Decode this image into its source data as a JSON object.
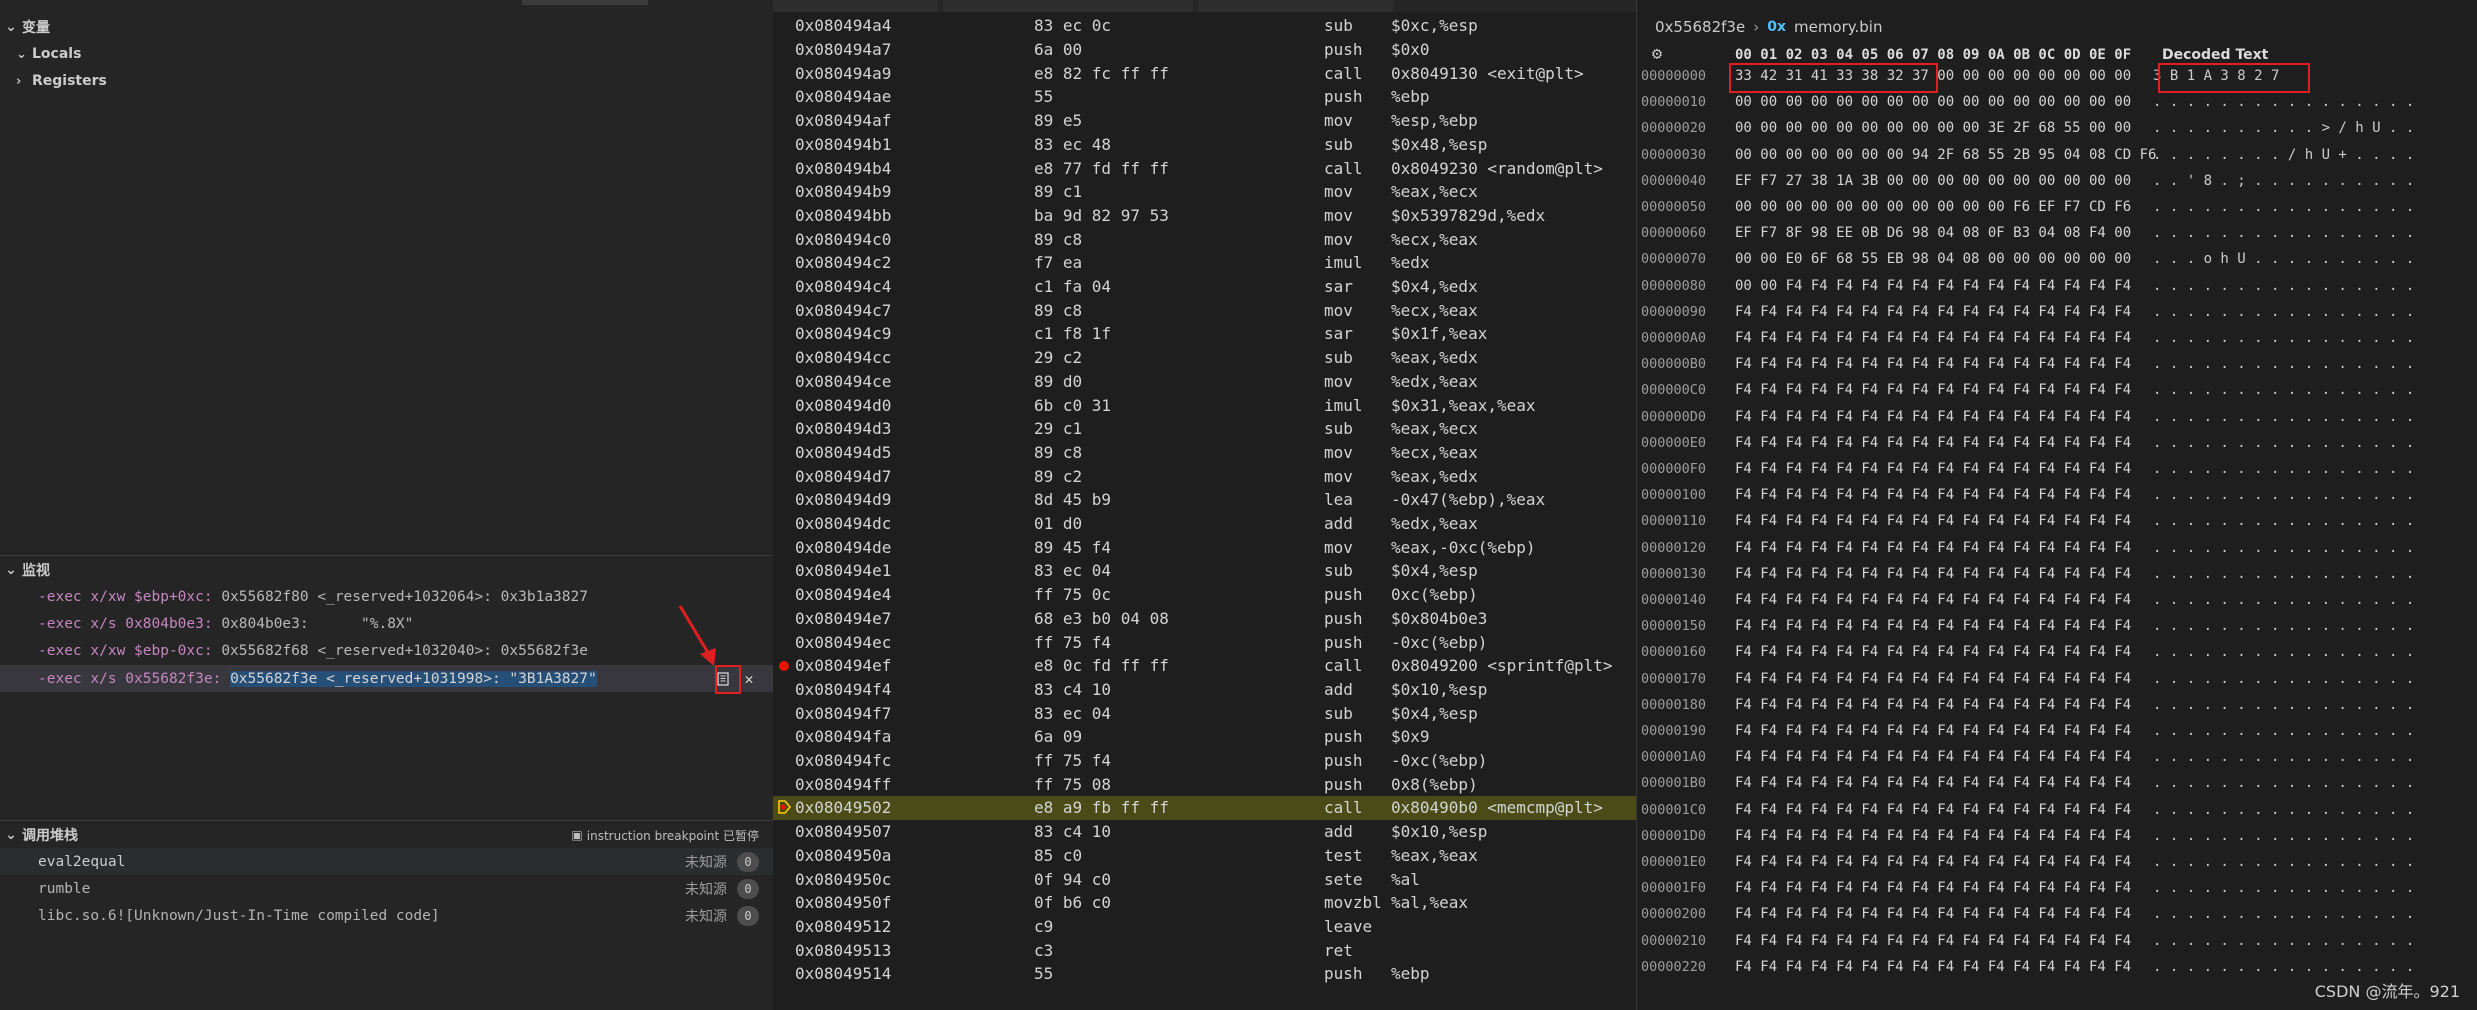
{
  "left_panel": {
    "variables": {
      "title": "变量",
      "items": [
        "Locals",
        "Registers"
      ]
    },
    "watch": {
      "title": "监视",
      "items": [
        {
          "expr": "-exec x/xw $ebp+0xc: ",
          "value": "0x55682f80 <_reserved+1032064>: 0x3b1a3827"
        },
        {
          "expr": "-exec x/s 0x804b0e3: ",
          "value": "0x804b0e3:      \"%.8X\""
        },
        {
          "expr": "-exec x/xw $ebp-0xc: ",
          "value": "0x55682f68 <_reserved+1032040>: 0x55682f3e"
        },
        {
          "expr": "-exec x/s 0x55682f3e: ",
          "value": "0x55682f3e <_reserved+1031998>: \"3B1A3827\""
        }
      ],
      "copy_icon": "copy-icon",
      "close_icon": "close-icon"
    },
    "call_stack": {
      "title": "调用堆栈",
      "status": "instruction breakpoint 已暂停",
      "frames": [
        {
          "name": "eval2equal",
          "source": "未知源",
          "badge": "0"
        },
        {
          "name": "rumble",
          "source": "未知源",
          "badge": "0"
        },
        {
          "name": "libc.so.6![Unknown/Just-In-Time compiled code]",
          "source": "未知源",
          "badge": "0"
        }
      ]
    }
  },
  "disassembly": {
    "rows": [
      {
        "addr": "0x080494a4",
        "bytes": "83 ec 0c",
        "mn": "sub",
        "ops": "$0xc,%esp"
      },
      {
        "addr": "0x080494a7",
        "bytes": "6a 00",
        "mn": "push",
        "ops": "$0x0"
      },
      {
        "addr": "0x080494a9",
        "bytes": "e8 82 fc ff ff",
        "mn": "call",
        "ops": "0x8049130 <exit@plt>"
      },
      {
        "addr": "0x080494ae",
        "bytes": "55",
        "mn": "push",
        "ops": "%ebp"
      },
      {
        "addr": "0x080494af",
        "bytes": "89 e5",
        "mn": "mov",
        "ops": "%esp,%ebp"
      },
      {
        "addr": "0x080494b1",
        "bytes": "83 ec 48",
        "mn": "sub",
        "ops": "$0x48,%esp"
      },
      {
        "addr": "0x080494b4",
        "bytes": "e8 77 fd ff ff",
        "mn": "call",
        "ops": "0x8049230 <random@plt>"
      },
      {
        "addr": "0x080494b9",
        "bytes": "89 c1",
        "mn": "mov",
        "ops": "%eax,%ecx"
      },
      {
        "addr": "0x080494bb",
        "bytes": "ba 9d 82 97 53",
        "mn": "mov",
        "ops": "$0x5397829d,%edx"
      },
      {
        "addr": "0x080494c0",
        "bytes": "89 c8",
        "mn": "mov",
        "ops": "%ecx,%eax"
      },
      {
        "addr": "0x080494c2",
        "bytes": "f7 ea",
        "mn": "imul",
        "ops": "%edx"
      },
      {
        "addr": "0x080494c4",
        "bytes": "c1 fa 04",
        "mn": "sar",
        "ops": "$0x4,%edx"
      },
      {
        "addr": "0x080494c7",
        "bytes": "89 c8",
        "mn": "mov",
        "ops": "%ecx,%eax"
      },
      {
        "addr": "0x080494c9",
        "bytes": "c1 f8 1f",
        "mn": "sar",
        "ops": "$0x1f,%eax"
      },
      {
        "addr": "0x080494cc",
        "bytes": "29 c2",
        "mn": "sub",
        "ops": "%eax,%edx"
      },
      {
        "addr": "0x080494ce",
        "bytes": "89 d0",
        "mn": "mov",
        "ops": "%edx,%eax"
      },
      {
        "addr": "0x080494d0",
        "bytes": "6b c0 31",
        "mn": "imul",
        "ops": "$0x31,%eax,%eax"
      },
      {
        "addr": "0x080494d3",
        "bytes": "29 c1",
        "mn": "sub",
        "ops": "%eax,%ecx"
      },
      {
        "addr": "0x080494d5",
        "bytes": "89 c8",
        "mn": "mov",
        "ops": "%ecx,%eax"
      },
      {
        "addr": "0x080494d7",
        "bytes": "89 c2",
        "mn": "mov",
        "ops": "%eax,%edx"
      },
      {
        "addr": "0x080494d9",
        "bytes": "8d 45 b9",
        "mn": "lea",
        "ops": "-0x47(%ebp),%eax"
      },
      {
        "addr": "0x080494dc",
        "bytes": "01 d0",
        "mn": "add",
        "ops": "%edx,%eax"
      },
      {
        "addr": "0x080494de",
        "bytes": "89 45 f4",
        "mn": "mov",
        "ops": "%eax,-0xc(%ebp)"
      },
      {
        "addr": "0x080494e1",
        "bytes": "83 ec 04",
        "mn": "sub",
        "ops": "$0x4,%esp"
      },
      {
        "addr": "0x080494e4",
        "bytes": "ff 75 0c",
        "mn": "push",
        "ops": "0xc(%ebp)"
      },
      {
        "addr": "0x080494e7",
        "bytes": "68 e3 b0 04 08",
        "mn": "push",
        "ops": "$0x804b0e3"
      },
      {
        "addr": "0x080494ec",
        "bytes": "ff 75 f4",
        "mn": "push",
        "ops": "-0xc(%ebp)"
      },
      {
        "addr": "0x080494ef",
        "bytes": "e8 0c fd ff ff",
        "mn": "call",
        "ops": "0x8049200 <sprintf@plt>",
        "breakpoint": true
      },
      {
        "addr": "0x080494f4",
        "bytes": "83 c4 10",
        "mn": "add",
        "ops": "$0x10,%esp"
      },
      {
        "addr": "0x080494f7",
        "bytes": "83 ec 04",
        "mn": "sub",
        "ops": "$0x4,%esp"
      },
      {
        "addr": "0x080494fa",
        "bytes": "6a 09",
        "mn": "push",
        "ops": "$0x9"
      },
      {
        "addr": "0x080494fc",
        "bytes": "ff 75 f4",
        "mn": "push",
        "ops": "-0xc(%ebp)"
      },
      {
        "addr": "0x080494ff",
        "bytes": "ff 75 08",
        "mn": "push",
        "ops": "0x8(%ebp)"
      },
      {
        "addr": "0x08049502",
        "bytes": "e8 a9 fb ff ff",
        "mn": "call",
        "ops": "0x80490b0 <memcmp@plt>",
        "current": true
      },
      {
        "addr": "0x08049507",
        "bytes": "83 c4 10",
        "mn": "add",
        "ops": "$0x10,%esp"
      },
      {
        "addr": "0x0804950a",
        "bytes": "85 c0",
        "mn": "test",
        "ops": "%eax,%eax"
      },
      {
        "addr": "0x0804950c",
        "bytes": "0f 94 c0",
        "mn": "sete",
        "ops": "%al"
      },
      {
        "addr": "0x0804950f",
        "bytes": "0f b6 c0",
        "mn": "movzbl",
        "ops": "%al,%eax"
      },
      {
        "addr": "0x08049512",
        "bytes": "c9",
        "mn": "leave",
        "ops": ""
      },
      {
        "addr": "0x08049513",
        "bytes": "c3",
        "mn": "ret",
        "ops": ""
      },
      {
        "addr": "0x08049514",
        "bytes": "55",
        "mn": "push",
        "ops": "%ebp"
      }
    ]
  },
  "memory": {
    "address": "0x55682f3e",
    "hex_label": "0x",
    "file": "memory.bin",
    "header": "00 01 02 03 04 05 06 07 08 09 0A 0B 0C 0D 0E 0F",
    "decoded_header": "Decoded Text",
    "rows": [
      {
        "off": "00000000",
        "hex": "33 42 31 41 33 38 32 37 00 00 00 00 00 00 00 00",
        "txt": "3 B 1 A 3 8 2 7"
      },
      {
        "off": "00000010",
        "hex": "00 00 00 00 00 00 00 00 00 00 00 00 00 00 00 00",
        "txt": ". . . . . . . . . . . . . . . ."
      },
      {
        "off": "00000020",
        "hex": "00 00 00 00 00 00 00 00 00 00 3E 2F 68 55 00 00",
        "txt": ". . . . . . . . . . > / h U . ."
      },
      {
        "off": "00000030",
        "hex": "00 00 00 00 00 00 00 94 2F 68 55 2B 95 04 08 CD F6",
        "txt": ". . . . . . . . / h U + . . . ."
      },
      {
        "off": "00000040",
        "hex": "EF F7 27 38 1A 3B 00 00 00 00 00 00 00 00 00 00",
        "txt": ". . ' 8 . ; . . . . . . . . . ."
      },
      {
        "off": "00000050",
        "hex": "00 00 00 00 00 00 00 00 00 00 00 F6 EF F7 CD F6",
        "txt": ". . . . . . . . . . . . . . . ."
      },
      {
        "off": "00000060",
        "hex": "EF F7 8F 98 EE 0B D6 98 04 08 0F B3 04 08 F4 00",
        "txt": ". . . . . . . . . . . . . . . ."
      },
      {
        "off": "00000070",
        "hex": "00 00 E0 6F 68 55 EB 98 04 08 00 00 00 00 00 00",
        "txt": ". . . o h U . . . . . . . . . ."
      },
      {
        "off": "00000080",
        "hex": "00 00 F4 F4 F4 F4 F4 F4 F4 F4 F4 F4 F4 F4 F4 F4",
        "txt": ". . . . . . . . . . . . . . . ."
      },
      {
        "off": "00000090",
        "hex": "F4 F4 F4 F4 F4 F4 F4 F4 F4 F4 F4 F4 F4 F4 F4 F4",
        "txt": ". . . . . . . . . . . . . . . ."
      },
      {
        "off": "000000A0",
        "hex": "F4 F4 F4 F4 F4 F4 F4 F4 F4 F4 F4 F4 F4 F4 F4 F4",
        "txt": ". . . . . . . . . . . . . . . ."
      },
      {
        "off": "000000B0",
        "hex": "F4 F4 F4 F4 F4 F4 F4 F4 F4 F4 F4 F4 F4 F4 F4 F4",
        "txt": ". . . . . . . . . . . . . . . ."
      },
      {
        "off": "000000C0",
        "hex": "F4 F4 F4 F4 F4 F4 F4 F4 F4 F4 F4 F4 F4 F4 F4 F4",
        "txt": ". . . . . . . . . . . . . . . ."
      },
      {
        "off": "000000D0",
        "hex": "F4 F4 F4 F4 F4 F4 F4 F4 F4 F4 F4 F4 F4 F4 F4 F4",
        "txt": ". . . . . . . . . . . . . . . ."
      },
      {
        "off": "000000E0",
        "hex": "F4 F4 F4 F4 F4 F4 F4 F4 F4 F4 F4 F4 F4 F4 F4 F4",
        "txt": ". . . . . . . . . . . . . . . ."
      },
      {
        "off": "000000F0",
        "hex": "F4 F4 F4 F4 F4 F4 F4 F4 F4 F4 F4 F4 F4 F4 F4 F4",
        "txt": ". . . . . . . . . . . . . . . ."
      },
      {
        "off": "00000100",
        "hex": "F4 F4 F4 F4 F4 F4 F4 F4 F4 F4 F4 F4 F4 F4 F4 F4",
        "txt": ". . . . . . . . . . . . . . . ."
      },
      {
        "off": "00000110",
        "hex": "F4 F4 F4 F4 F4 F4 F4 F4 F4 F4 F4 F4 F4 F4 F4 F4",
        "txt": ". . . . . . . . . . . . . . . ."
      },
      {
        "off": "00000120",
        "hex": "F4 F4 F4 F4 F4 F4 F4 F4 F4 F4 F4 F4 F4 F4 F4 F4",
        "txt": ". . . . . . . . . . . . . . . ."
      },
      {
        "off": "00000130",
        "hex": "F4 F4 F4 F4 F4 F4 F4 F4 F4 F4 F4 F4 F4 F4 F4 F4",
        "txt": ". . . . . . . . . . . . . . . ."
      },
      {
        "off": "00000140",
        "hex": "F4 F4 F4 F4 F4 F4 F4 F4 F4 F4 F4 F4 F4 F4 F4 F4",
        "txt": ". . . . . . . . . . . . . . . ."
      },
      {
        "off": "00000150",
        "hex": "F4 F4 F4 F4 F4 F4 F4 F4 F4 F4 F4 F4 F4 F4 F4 F4",
        "txt": ". . . . . . . . . . . . . . . ."
      },
      {
        "off": "00000160",
        "hex": "F4 F4 F4 F4 F4 F4 F4 F4 F4 F4 F4 F4 F4 F4 F4 F4",
        "txt": ". . . . . . . . . . . . . . . ."
      },
      {
        "off": "00000170",
        "hex": "F4 F4 F4 F4 F4 F4 F4 F4 F4 F4 F4 F4 F4 F4 F4 F4",
        "txt": ". . . . . . . . . . . . . . . ."
      },
      {
        "off": "00000180",
        "hex": "F4 F4 F4 F4 F4 F4 F4 F4 F4 F4 F4 F4 F4 F4 F4 F4",
        "txt": ". . . . . . . . . . . . . . . ."
      },
      {
        "off": "00000190",
        "hex": "F4 F4 F4 F4 F4 F4 F4 F4 F4 F4 F4 F4 F4 F4 F4 F4",
        "txt": ". . . . . . . . . . . . . . . ."
      },
      {
        "off": "000001A0",
        "hex": "F4 F4 F4 F4 F4 F4 F4 F4 F4 F4 F4 F4 F4 F4 F4 F4",
        "txt": ". . . . . . . . . . . . . . . ."
      },
      {
        "off": "000001B0",
        "hex": "F4 F4 F4 F4 F4 F4 F4 F4 F4 F4 F4 F4 F4 F4 F4 F4",
        "txt": ". . . . . . . . . . . . . . . ."
      },
      {
        "off": "000001C0",
        "hex": "F4 F4 F4 F4 F4 F4 F4 F4 F4 F4 F4 F4 F4 F4 F4 F4",
        "txt": ". . . . . . . . . . . . . . . ."
      },
      {
        "off": "000001D0",
        "hex": "F4 F4 F4 F4 F4 F4 F4 F4 F4 F4 F4 F4 F4 F4 F4 F4",
        "txt": ". . . . . . . . . . . . . . . ."
      },
      {
        "off": "000001E0",
        "hex": "F4 F4 F4 F4 F4 F4 F4 F4 F4 F4 F4 F4 F4 F4 F4 F4",
        "txt": ". . . . . . . . . . . . . . . ."
      },
      {
        "off": "000001F0",
        "hex": "F4 F4 F4 F4 F4 F4 F4 F4 F4 F4 F4 F4 F4 F4 F4 F4",
        "txt": ". . . . . . . . . . . . . . . ."
      },
      {
        "off": "00000200",
        "hex": "F4 F4 F4 F4 F4 F4 F4 F4 F4 F4 F4 F4 F4 F4 F4 F4",
        "txt": ". . . . . . . . . . . . . . . ."
      },
      {
        "off": "00000210",
        "hex": "F4 F4 F4 F4 F4 F4 F4 F4 F4 F4 F4 F4 F4 F4 F4 F4",
        "txt": ". . . . . . . . . . . . . . . ."
      },
      {
        "off": "00000220",
        "hex": "F4 F4 F4 F4 F4 F4 F4 F4 F4 F4 F4 F4 F4 F4 F4 F4",
        "txt": ". . . . . . . . . . . . . . . ."
      }
    ]
  },
  "watermark": "CSDN @流年。921",
  "colors": {
    "expr": "#c586c0",
    "current_line": "#4b4b18",
    "breakpoint": "#e51400",
    "highlight_box": "#e02020",
    "selection": "#264f78"
  }
}
